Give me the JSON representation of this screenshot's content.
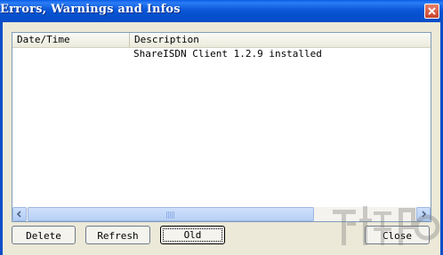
{
  "window": {
    "title": "Errors, Warnings and Infos"
  },
  "listview": {
    "columns": [
      "Date/Time",
      "Description"
    ],
    "rows": [
      {
        "datetime": "",
        "description": "ShareISDN Client 1.2.9 installed"
      }
    ]
  },
  "buttons": {
    "delete": "Delete",
    "refresh": "Refresh",
    "old": "Old",
    "close": "Close"
  },
  "icons": {
    "close": "close-icon",
    "scroll_left": "scroll-left-arrow-icon",
    "scroll_right": "scroll-right-arrow-icon",
    "watermark": "watermark-logo"
  },
  "colors": {
    "titlebar": "#0a57d8",
    "window_bg": "#ece9d8"
  }
}
